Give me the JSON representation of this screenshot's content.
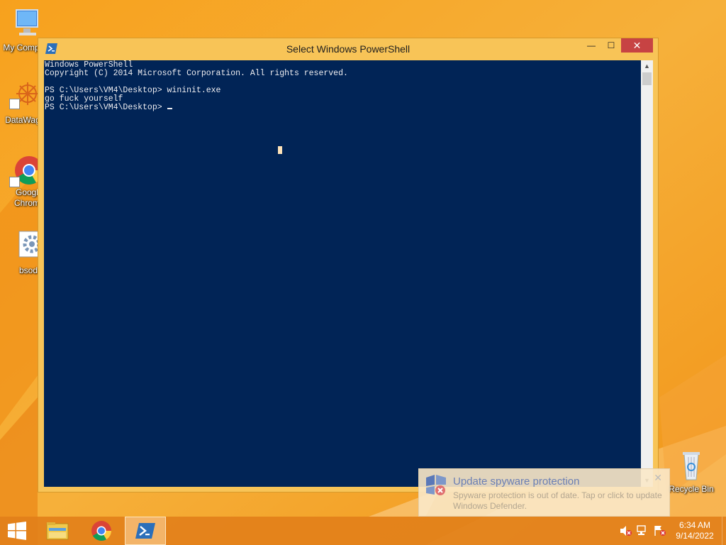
{
  "desktop": {
    "icons": [
      {
        "label": "My Comp",
        "icon": "computer-icon"
      },
      {
        "label": "DataWag",
        "icon": "datawag-shortcut-icon"
      },
      {
        "label": "Googl\nChrom",
        "icon": "chrome-shortcut-icon"
      },
      {
        "label": "bsod",
        "icon": "gear-app-icon"
      },
      {
        "label": "Recycle Bin",
        "icon": "recycle-bin-icon"
      }
    ]
  },
  "window": {
    "title": "Select Windows PowerShell",
    "icon": "powershell-icon",
    "buttons": {
      "minimize": "—",
      "maximize": "☐",
      "close": "✕"
    },
    "console_lines": [
      "Windows PowerShell",
      "Copyright (C) 2014 Microsoft Corporation. All rights reserved.",
      "",
      "PS C:\\Users\\VM4\\Desktop> wininit.exe",
      "go fuck yourself",
      "PS C:\\Users\\VM4\\Desktop> "
    ],
    "scroll_up": "▲",
    "scroll_down": "▼",
    "colors": {
      "console_bg": "#012456",
      "console_fg": "#eeedf0"
    }
  },
  "notification": {
    "title": "Update spyware protection",
    "body": "Spyware protection is out of date. Tap or click to update Windows Defender.",
    "close": "✕",
    "icon": "defender-warning-icon"
  },
  "taskbar": {
    "items": [
      "start-icon",
      "file-explorer-icon",
      "chrome-icon",
      "powershell-icon"
    ],
    "tray_icons": [
      "volume-muted-icon",
      "network-icon",
      "action-center-flag-icon"
    ],
    "time": "6:34 AM",
    "date": "9/14/2022"
  }
}
